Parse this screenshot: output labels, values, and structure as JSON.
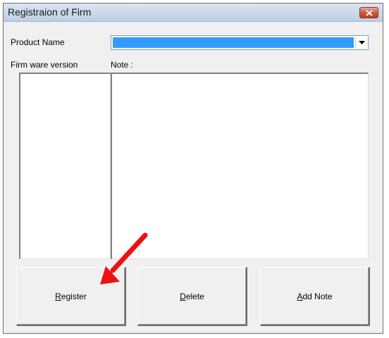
{
  "window": {
    "title": "Registraion of Firm"
  },
  "form": {
    "product_name_label": "Product Name",
    "product_name_value": "",
    "firmware_label": "Firm ware version",
    "note_label": "Note :"
  },
  "buttons": {
    "register": {
      "mnemonic": "R",
      "rest": "egister"
    },
    "delete": {
      "mnemonic": "D",
      "rest": "elete"
    },
    "add_note": {
      "mnemonic": "A",
      "rest": "dd Note"
    }
  },
  "colors": {
    "selection": "#3399ff",
    "annotation_arrow": "#ee1111"
  },
  "icons": {
    "close": "close-icon",
    "dropdown": "chevron-down-icon",
    "annotation": "red-arrow-icon"
  }
}
